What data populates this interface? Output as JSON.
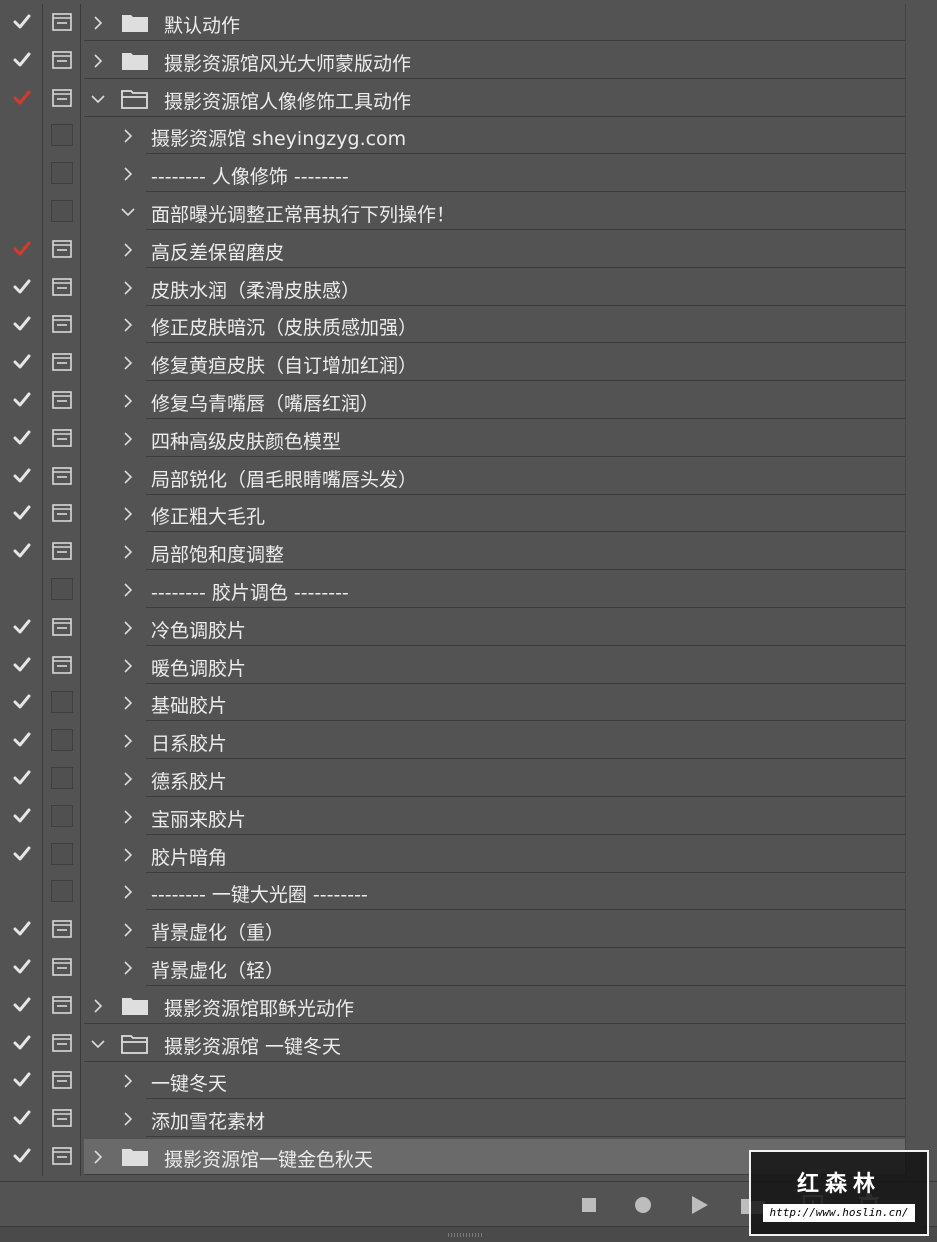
{
  "colors": {
    "panel_bg": "#535353",
    "row_selected": "#6a6a6a",
    "check_white": "#e6e6e6",
    "check_red": "#d9392c"
  },
  "rows": [
    {
      "label": "默认动作",
      "level": 0,
      "check": "white",
      "dialog": "icon",
      "expanded": false,
      "folder": true
    },
    {
      "label": "摄影资源馆风光大师蒙版动作",
      "level": 0,
      "check": "white",
      "dialog": "icon",
      "expanded": false,
      "folder": true
    },
    {
      "label": "摄影资源馆人像修饰工具动作",
      "level": 0,
      "check": "red",
      "dialog": "icon",
      "expanded": true,
      "folder": true
    },
    {
      "label": "摄影资源馆 sheyingzyg.com",
      "level": 1,
      "check": "none",
      "dialog": "empty",
      "expanded": false
    },
    {
      "label": "-------- 人像修饰 --------",
      "level": 1,
      "check": "none",
      "dialog": "empty",
      "expanded": false
    },
    {
      "label": "面部曝光调整正常再执行下列操作！",
      "level": 1,
      "check": "none",
      "dialog": "empty",
      "expanded": true
    },
    {
      "label": "高反差保留磨皮",
      "level": 1,
      "check": "red",
      "dialog": "icon",
      "expanded": false
    },
    {
      "label": "皮肤水润（柔滑皮肤感）",
      "level": 1,
      "check": "white",
      "dialog": "icon",
      "expanded": false
    },
    {
      "label": "修正皮肤暗沉（皮肤质感加强）",
      "level": 1,
      "check": "white",
      "dialog": "icon",
      "expanded": false
    },
    {
      "label": "修复黄疸皮肤（自订增加红润）",
      "level": 1,
      "check": "white",
      "dialog": "icon",
      "expanded": false
    },
    {
      "label": "修复乌青嘴唇（嘴唇红润）",
      "level": 1,
      "check": "white",
      "dialog": "icon",
      "expanded": false
    },
    {
      "label": "四种高级皮肤颜色模型",
      "level": 1,
      "check": "white",
      "dialog": "icon",
      "expanded": false
    },
    {
      "label": "局部锐化（眉毛眼睛嘴唇头发）",
      "level": 1,
      "check": "white",
      "dialog": "icon",
      "expanded": false
    },
    {
      "label": "修正粗大毛孔",
      "level": 1,
      "check": "white",
      "dialog": "icon",
      "expanded": false
    },
    {
      "label": "局部饱和度调整",
      "level": 1,
      "check": "white",
      "dialog": "icon",
      "expanded": false
    },
    {
      "label": "-------- 胶片调色 --------",
      "level": 1,
      "check": "none",
      "dialog": "empty",
      "expanded": false
    },
    {
      "label": "冷色调胶片",
      "level": 1,
      "check": "white",
      "dialog": "icon",
      "expanded": false
    },
    {
      "label": "暖色调胶片",
      "level": 1,
      "check": "white",
      "dialog": "icon",
      "expanded": false
    },
    {
      "label": "基础胶片",
      "level": 1,
      "check": "white",
      "dialog": "empty",
      "expanded": false
    },
    {
      "label": "日系胶片",
      "level": 1,
      "check": "white",
      "dialog": "empty",
      "expanded": false
    },
    {
      "label": "德系胶片",
      "level": 1,
      "check": "white",
      "dialog": "empty",
      "expanded": false
    },
    {
      "label": "宝丽来胶片",
      "level": 1,
      "check": "white",
      "dialog": "empty",
      "expanded": false
    },
    {
      "label": "胶片暗角",
      "level": 1,
      "check": "white",
      "dialog": "empty",
      "expanded": false
    },
    {
      "label": "-------- 一键大光圈 --------",
      "level": 1,
      "check": "none",
      "dialog": "empty",
      "expanded": false
    },
    {
      "label": "背景虚化（重）",
      "level": 1,
      "check": "white",
      "dialog": "icon",
      "expanded": false
    },
    {
      "label": "背景虚化（轻）",
      "level": 1,
      "check": "white",
      "dialog": "icon",
      "expanded": false
    },
    {
      "label": "摄影资源馆耶稣光动作",
      "level": 0,
      "check": "white",
      "dialog": "icon",
      "expanded": false,
      "folder": true
    },
    {
      "label": "摄影资源馆 一键冬天",
      "level": 0,
      "check": "white",
      "dialog": "icon",
      "expanded": true,
      "folder": true
    },
    {
      "label": " 一键冬天",
      "level": 1,
      "check": "white",
      "dialog": "icon",
      "expanded": false
    },
    {
      "label": "添加雪花素材",
      "level": 1,
      "check": "white",
      "dialog": "icon",
      "expanded": false
    },
    {
      "label": "摄影资源馆一键金色秋天",
      "level": 0,
      "check": "white",
      "dialog": "icon",
      "expanded": false,
      "folder": true,
      "selected": true
    }
  ],
  "toolbar": {
    "icons": [
      "stop-icon",
      "record-icon",
      "play-icon",
      "new-set-icon",
      "new-action-icon",
      "delete-icon"
    ]
  },
  "watermark": {
    "title": "红森林",
    "url": "http://www.hoslin.cn/"
  }
}
